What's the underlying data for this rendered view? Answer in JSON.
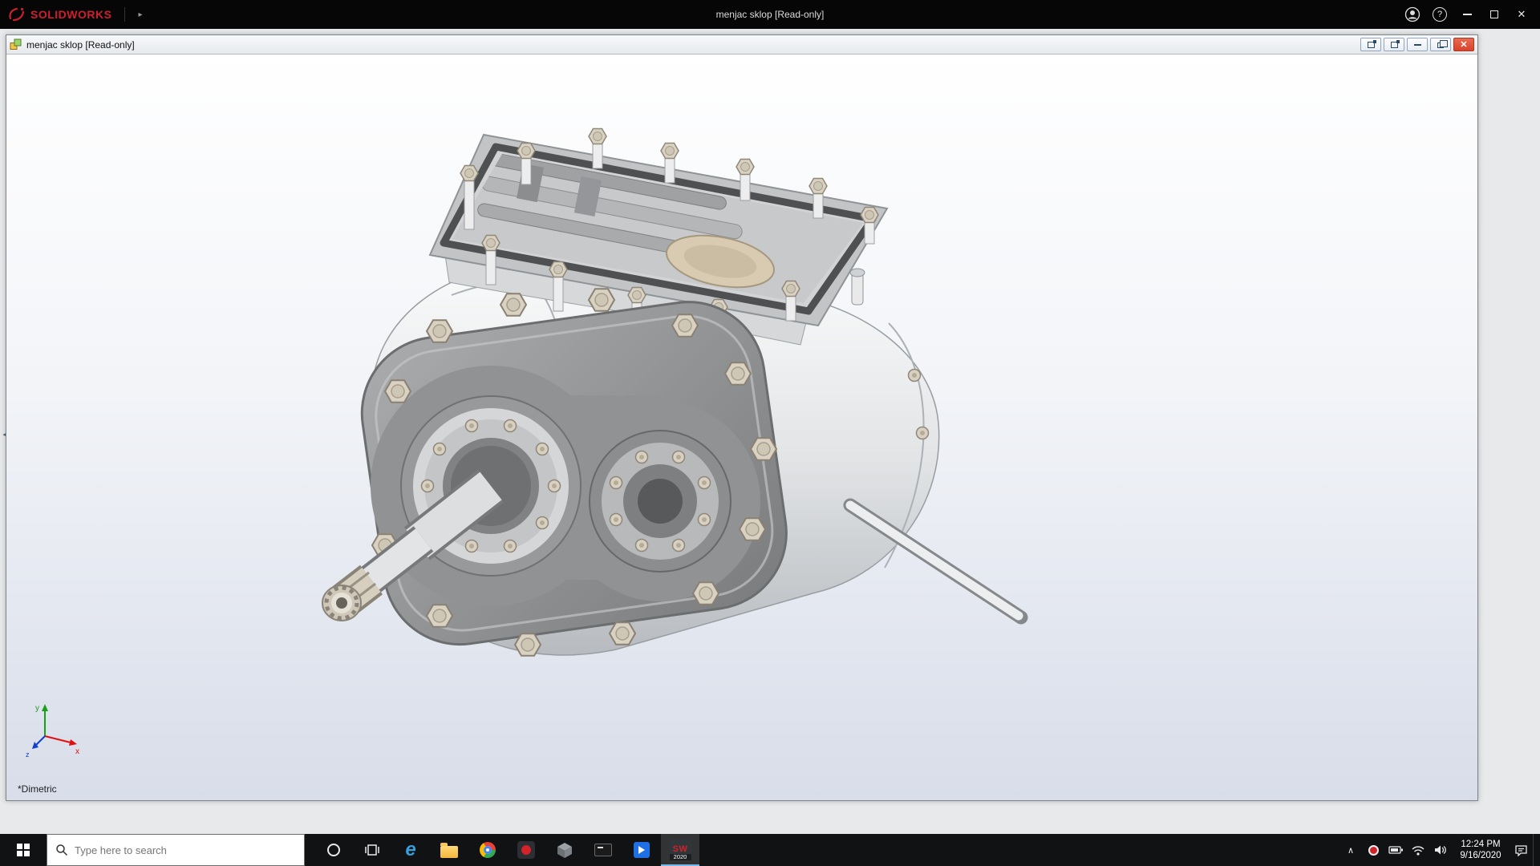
{
  "app": {
    "brand": "SOLIDWORKS",
    "title": "menjac sklop [Read-only]"
  },
  "doc": {
    "title": "menjac sklop [Read-only]",
    "view_orientation": "*Dimetric",
    "triad": {
      "x": "x",
      "y": "y",
      "z": "z"
    }
  },
  "taskbar": {
    "search": {
      "placeholder": "Type here to search"
    },
    "apps": [
      "cortana",
      "task-view",
      "edge",
      "file-explorer",
      "chrome",
      "app-red",
      "cube-app",
      "terminal",
      "media-app",
      "solidworks"
    ],
    "solidworks": {
      "glyph": "SW",
      "year": "2020"
    },
    "tray": {
      "time": "12:24 PM",
      "date": "9/16/2020"
    }
  },
  "icons": {
    "help": "?",
    "close": "✕",
    "brand_arrow": "▸",
    "chevron_up": "∧",
    "left_collapse": "◂",
    "edge_glyph": "e"
  },
  "colors": {
    "brand_red": "#cf1f2e",
    "titlebar_bg": "#060606",
    "taskbar_bg": "#101214",
    "doc_close_red": "#d8432c",
    "viewport_top": "#ffffff",
    "viewport_bottom": "#d8dde9",
    "active_app_underline": "#76b9ed"
  }
}
